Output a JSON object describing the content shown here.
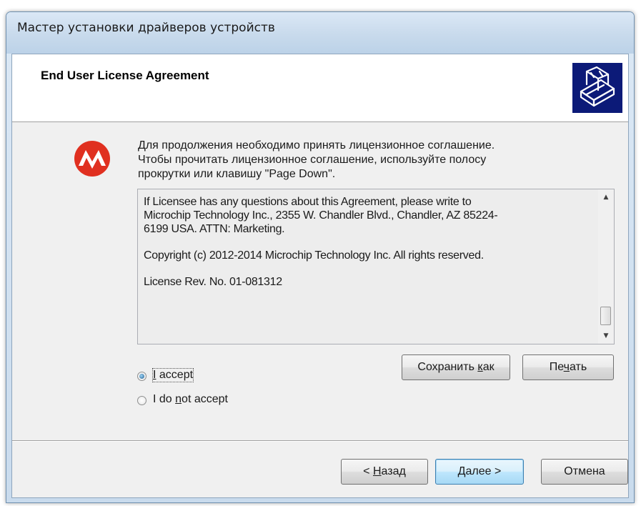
{
  "window": {
    "title": "Мастер установки драйверов устройств"
  },
  "header": {
    "title": "End User License Agreement",
    "icon": "hardware-install-icon"
  },
  "logo": {
    "icon": "microchip-logo-icon",
    "color": "#e03020"
  },
  "intro": {
    "line1": "Для продолжения необходимо принять лицензионное соглашение.",
    "line2": "Чтобы прочитать лицензионное соглашение, используйте полосу",
    "line3": "прокрутки или клавишу \"Page Down\"."
  },
  "license": {
    "paragraph1": "If Licensee has any questions about this Agreement, please write to\nMicrochip Technology Inc., 2355 W. Chandler Blvd., Chandler, AZ 85224-\n6199 USA. ATTN: Marketing.",
    "paragraph2": "Copyright (c) 2012-2014 Microchip Technology Inc.  All rights reserved.",
    "paragraph3": "License Rev. No. 01-081312"
  },
  "buttons": {
    "save_as_pre": "Сохранить ",
    "save_as_accel": "к",
    "save_as_post": "ак",
    "print_pre": "Пе",
    "print_accel": "ч",
    "print_post": "ать",
    "back_pre": "< ",
    "back_accel": "Н",
    "back_post": "азад",
    "next_label": "Далее >",
    "cancel_label": "Отмена"
  },
  "options": {
    "accept_accel": "I",
    "accept_post": " accept",
    "accept_selected": true,
    "decline_pre": "I do ",
    "decline_accel": "n",
    "decline_post": "ot accept"
  },
  "colors": {
    "header_icon_bg": "#0c1a78",
    "default_button_border": "#3c7fb1"
  }
}
